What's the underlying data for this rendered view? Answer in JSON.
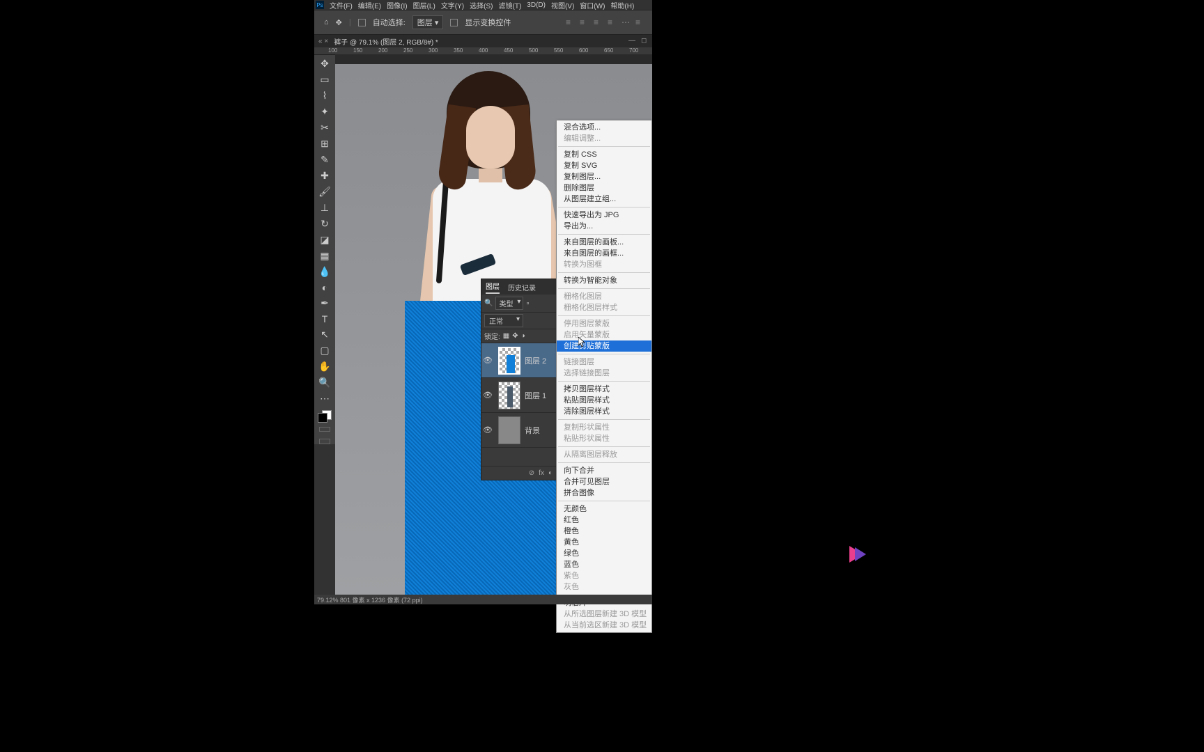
{
  "menubar": {
    "items": [
      "文件(F)",
      "编辑(E)",
      "图像(I)",
      "图层(L)",
      "文字(Y)",
      "选择(S)",
      "滤镜(T)",
      "3D(D)",
      "视图(V)",
      "窗口(W)",
      "帮助(H)"
    ]
  },
  "optbar": {
    "auto_select": "自动选择:",
    "target": "图层",
    "show_transform": "显示变换控件"
  },
  "doc": {
    "title": "裤子 @ 79.1% (图层 2, RGB/8#) *"
  },
  "ruler": {
    "marks": [
      "100",
      "150",
      "200",
      "250",
      "300",
      "350",
      "400",
      "450",
      "500",
      "550",
      "600",
      "650",
      "700"
    ]
  },
  "layers_panel": {
    "tab_layers": "图层",
    "tab_history": "历史记录",
    "kind": "类型",
    "blend": "正常",
    "lock_label": "锁定:",
    "layers": [
      {
        "name": "图层 2"
      },
      {
        "name": "图层 1"
      },
      {
        "name": "背景"
      }
    ]
  },
  "context_menu": {
    "items": [
      {
        "t": "混合选项...",
        "d": false
      },
      {
        "t": "编辑调整...",
        "d": true
      },
      {
        "sep": true
      },
      {
        "t": "复制 CSS",
        "d": false
      },
      {
        "t": "复制 SVG",
        "d": false
      },
      {
        "t": "复制图层...",
        "d": false
      },
      {
        "t": "删除图层",
        "d": false
      },
      {
        "t": "从图层建立组...",
        "d": false
      },
      {
        "sep": true
      },
      {
        "t": "快速导出为 JPG",
        "d": false
      },
      {
        "t": "导出为...",
        "d": false
      },
      {
        "sep": true
      },
      {
        "t": "来自图层的画板...",
        "d": false
      },
      {
        "t": "来自图层的画框...",
        "d": false
      },
      {
        "t": "转换为图框",
        "d": true
      },
      {
        "sep": true
      },
      {
        "t": "转换为智能对象",
        "d": false
      },
      {
        "sep": true
      },
      {
        "t": "栅格化图层",
        "d": true
      },
      {
        "t": "栅格化图层样式",
        "d": true
      },
      {
        "sep": true
      },
      {
        "t": "停用图层蒙版",
        "d": true
      },
      {
        "t": "启用矢量蒙版",
        "d": true
      },
      {
        "t": "创建剪贴蒙版",
        "d": false,
        "hl": true
      },
      {
        "sep": true
      },
      {
        "t": "链接图层",
        "d": true
      },
      {
        "t": "选择链接图层",
        "d": true
      },
      {
        "sep": true
      },
      {
        "t": "拷贝图层样式",
        "d": false
      },
      {
        "t": "粘贴图层样式",
        "d": false
      },
      {
        "t": "清除图层样式",
        "d": false
      },
      {
        "sep": true
      },
      {
        "t": "复制形状属性",
        "d": true
      },
      {
        "t": "粘贴形状属性",
        "d": true
      },
      {
        "sep": true
      },
      {
        "t": "从隔离图层释放",
        "d": true
      },
      {
        "sep": true
      },
      {
        "t": "向下合并",
        "d": false
      },
      {
        "t": "合并可见图层",
        "d": false
      },
      {
        "t": "拼合图像",
        "d": false
      },
      {
        "sep": true
      },
      {
        "t": "无颜色",
        "d": false
      },
      {
        "t": "红色",
        "d": false
      },
      {
        "t": "橙色",
        "d": false
      },
      {
        "t": "黄色",
        "d": false
      },
      {
        "t": "绿色",
        "d": false
      },
      {
        "t": "蓝色",
        "d": false
      },
      {
        "t": "紫色",
        "d": true
      },
      {
        "t": "灰色",
        "d": true
      },
      {
        "sep": true
      },
      {
        "t": "明信片",
        "d": false
      },
      {
        "t": "从所选图层新建 3D 模型",
        "d": true
      },
      {
        "t": "从当前选区新建 3D 模型",
        "d": true
      }
    ]
  },
  "status": {
    "text": "79.12%  801 像素 x 1236 像素 (72 ppi)"
  }
}
